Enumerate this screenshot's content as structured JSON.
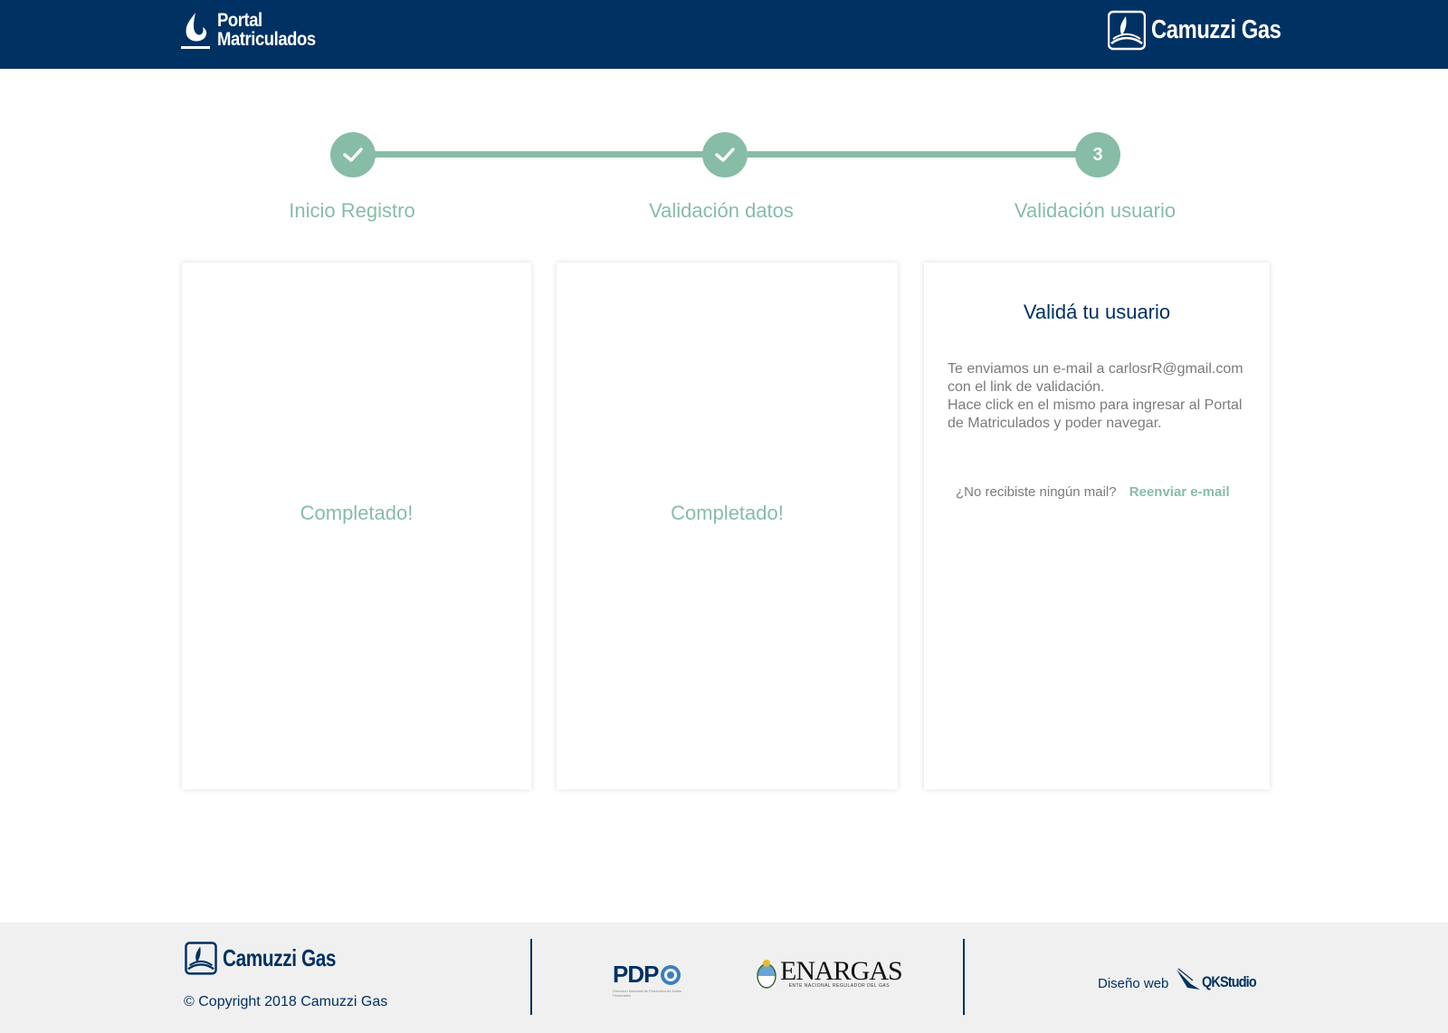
{
  "header": {
    "portal_line1": "Portal",
    "portal_line2": "Matriculados",
    "brand": "Camuzzi Gas"
  },
  "stepper": {
    "steps": [
      {
        "label": "Inicio Registro",
        "status": "completed"
      },
      {
        "label": "Validación datos",
        "status": "completed"
      },
      {
        "label": "Validación usuario",
        "status": "current",
        "number": "3"
      }
    ]
  },
  "cards": {
    "card1_status": "Completado!",
    "card2_status": "Completado!",
    "card3": {
      "title": "Validá tu usuario",
      "line1": "Te enviamos un e-mail a carlosrR@gmail.com con el link de validación.",
      "line2": "Hace click en el mismo para ingresar al Portal de Matriculados y poder navegar.",
      "resend_question": "¿No recibiste ningún mail?",
      "resend_link": "Reenviar e-mail"
    }
  },
  "footer": {
    "brand": "Camuzzi Gas",
    "copyright": "© Copyright 2018 Camuzzi Gas",
    "pdp": "PDP",
    "pdp_sub": "Dirección Nacional de Protección de Datos Personales",
    "enargas": "ENARGAS",
    "enargas_sub": "ENTE NACIONAL REGULADOR DEL GAS",
    "design_label": "Diseño web",
    "design_brand": "QKStudio"
  },
  "colors": {
    "primary": "#003163",
    "accent": "#87bca6",
    "text_muted": "#7b7b7b",
    "footer_bg": "#f0f0f0"
  }
}
